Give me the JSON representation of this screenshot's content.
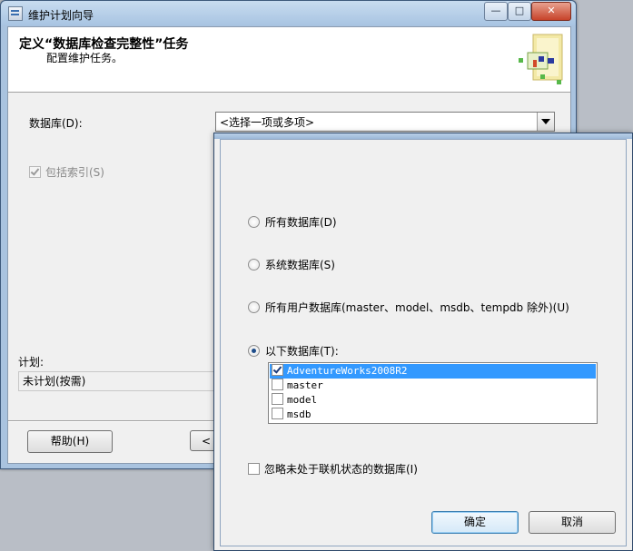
{
  "window": {
    "title": "维护计划向导",
    "minimize_glyph": "—",
    "maximize_glyph": "□",
    "close_glyph": "✕"
  },
  "header": {
    "title": "定义“数据库检查完整性”任务",
    "subtitle": "配置维护任务。"
  },
  "form": {
    "databases_label": "数据库(D):",
    "databases_value": "<选择一项或多项>",
    "include_indexes_label": "包括索引(S)",
    "include_indexes_checked": true,
    "include_indexes_enabled": false,
    "plan_label": "计划:",
    "plan_value": "未计划(按需)"
  },
  "footer": {
    "help_label": "帮助(H)",
    "back_label": "<"
  },
  "popup": {
    "options": [
      {
        "label": "所有数据库(D)",
        "selected": false
      },
      {
        "label": "系统数据库(S)",
        "selected": false
      },
      {
        "label": "所有用户数据库(master、model、msdb、tempdb 除外)(U)",
        "selected": false
      },
      {
        "label": "以下数据库(T):",
        "selected": true
      }
    ],
    "databases": [
      {
        "name": "AdventureWorks2008R2",
        "checked": true,
        "selected": true
      },
      {
        "name": "master",
        "checked": false,
        "selected": false
      },
      {
        "name": "model",
        "checked": false,
        "selected": false
      },
      {
        "name": "msdb",
        "checked": false,
        "selected": false
      }
    ],
    "ignore_offline_label": "忽略未处于联机状态的数据库(I)",
    "ignore_offline_checked": false,
    "ok_label": "确定",
    "cancel_label": "取消"
  }
}
